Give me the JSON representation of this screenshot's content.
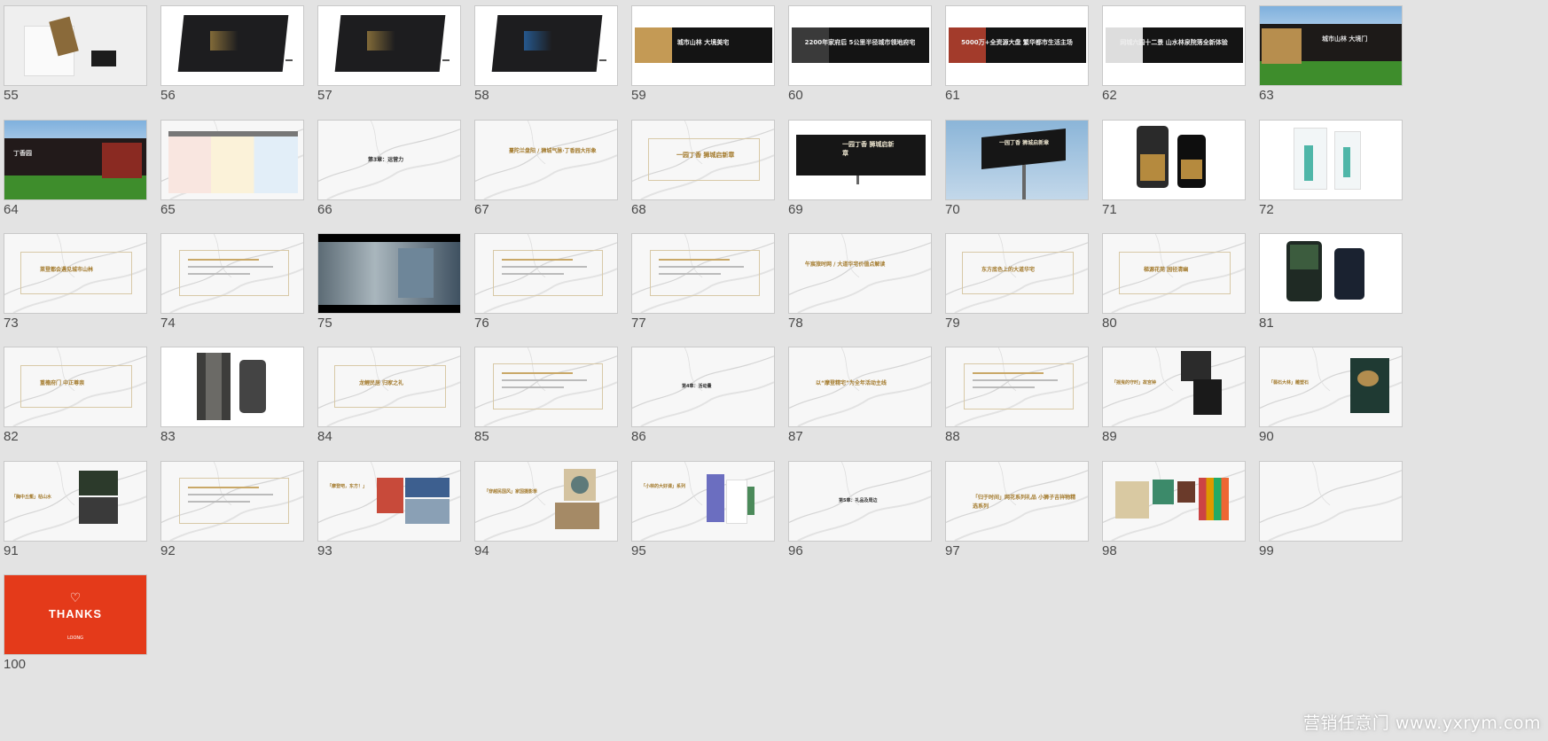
{
  "slides": [
    {
      "num": "55"
    },
    {
      "num": "56"
    },
    {
      "num": "57"
    },
    {
      "num": "58"
    },
    {
      "num": "59",
      "text": "城市山林 大境美宅"
    },
    {
      "num": "60",
      "text": "2200年家府后 5公里半径城市领地府宅"
    },
    {
      "num": "61",
      "text": "5000万+全资源大盘 繁华都市生活主场"
    },
    {
      "num": "62",
      "text": "网城六园十二景 山水林泉院落全新体验"
    },
    {
      "num": "63",
      "text": "城市山林 大境门"
    },
    {
      "num": "64",
      "text": "丁香园"
    },
    {
      "num": "65"
    },
    {
      "num": "66",
      "text": "第3章：运营力"
    },
    {
      "num": "67",
      "text": "蔓陀兰盘阳 / 狮城气脉·丁香园大形象"
    },
    {
      "num": "68",
      "text": "一园丁香 狮城启新章"
    },
    {
      "num": "69",
      "text": "一园丁香 狮城启新章"
    },
    {
      "num": "70",
      "text": "一园丁香 狮城启新章"
    },
    {
      "num": "71"
    },
    {
      "num": "72"
    },
    {
      "num": "73",
      "text": "莱登都会遇见城市山林"
    },
    {
      "num": "74"
    },
    {
      "num": "75"
    },
    {
      "num": "76"
    },
    {
      "num": "77"
    },
    {
      "num": "78",
      "text": "午宸旅时网 / 大道华宅价值点解读"
    },
    {
      "num": "79",
      "text": "东方底色上的大道华宅"
    },
    {
      "num": "80",
      "text": "梯源花苑 园径清幽"
    },
    {
      "num": "81"
    },
    {
      "num": "82",
      "text": "重檐府门 中正尊崇"
    },
    {
      "num": "83"
    },
    {
      "num": "84",
      "text": "龙鲤民居 归家之礼"
    },
    {
      "num": "85"
    },
    {
      "num": "86",
      "text": "第4章：活动量"
    },
    {
      "num": "87",
      "text": "以“摩登精宅”为全年活动主线"
    },
    {
      "num": "88"
    },
    {
      "num": "89",
      "text": "「摇曳的守时」故宫钟"
    },
    {
      "num": "90",
      "text": "「翡石大林」雕塑石"
    },
    {
      "num": "91",
      "text": "「胸中丘壑」枯山水"
    },
    {
      "num": "92"
    },
    {
      "num": "93",
      "text": "「摩登吧，东方！」"
    },
    {
      "num": "94",
      "text": "「穿越民国风」家国摄影季"
    },
    {
      "num": "95",
      "text": "「小林的大好课」系列"
    },
    {
      "num": "96",
      "text": "第5章：礼品及周边"
    },
    {
      "num": "97",
      "text": "「归于时间」网花系列礼品 小狮子吉祥物精选系列"
    },
    {
      "num": "98"
    },
    {
      "num": "99"
    },
    {
      "num": "100",
      "text": "THANKS",
      "sub": "LOONG"
    }
  ],
  "watermark": "营销任意门 www.yxrym.com",
  "colors": {
    "bg": "#e3e3e3",
    "gold": "#a37a2c",
    "thanks_red": "#e43a1a"
  }
}
